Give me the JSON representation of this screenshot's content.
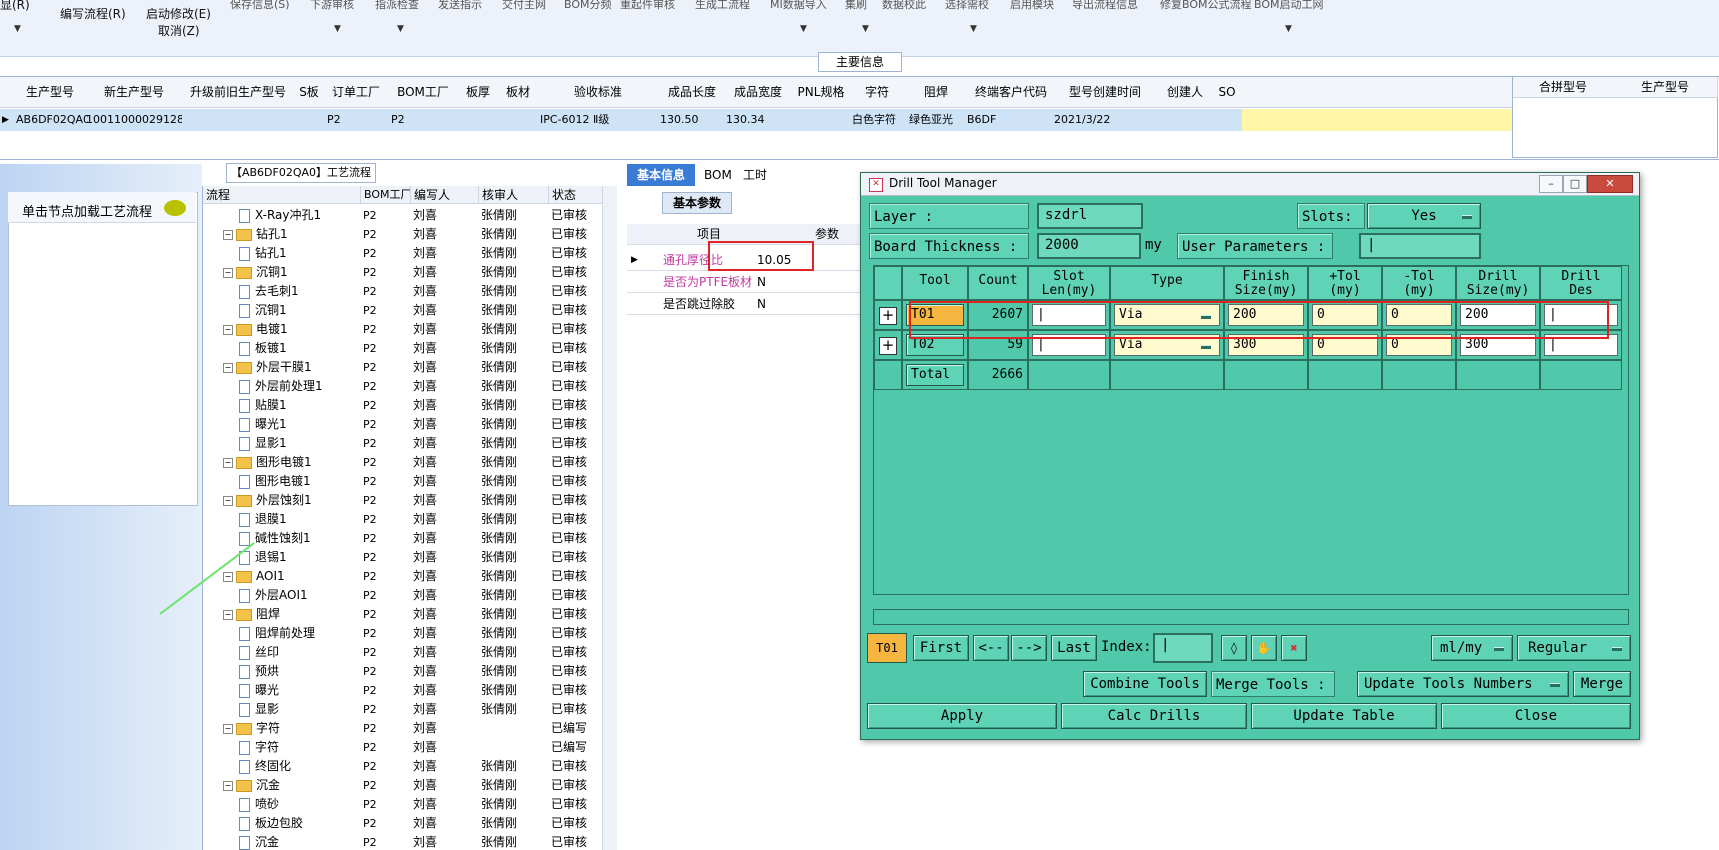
{
  "toolbar": {
    "menu_row": [
      "保存信息(S)",
      "下游审核",
      "指派检查",
      "发送指示",
      "交付主网",
      "BOM分频",
      "重起件审核",
      "生成工流程",
      "MI数据导入",
      "集刷",
      "数据校此",
      "选择需校",
      "启用模块",
      "导出流程信息",
      "修复BOM公式流程",
      "BOM启动工网"
    ],
    "edit_flow": "编写流程(R)",
    "start_modify": "启动修改(E)",
    "cancel": "取消(Z)"
  },
  "main_info": {
    "section_label": "主要信息",
    "headers": [
      "生产型号",
      "新生产型号",
      "升级前旧生产型号",
      "S板",
      "订单工厂",
      "BOM工厂",
      "板厚",
      "板材",
      "验收标准",
      "成品长度",
      "成品宽度",
      "PNL规格",
      "字符",
      "阻焊",
      "终端客户代码",
      "型号创建时间",
      "创建人",
      "SO"
    ],
    "row": [
      "AB6DF02QA0",
      "10011000029128",
      "",
      "",
      "P2",
      "P2",
      "",
      "",
      "IPC-6012 Ⅱ级",
      "130.50",
      "130.34",
      "",
      "白色字符",
      "绿色亚光",
      "B6DF",
      "2021/3/22",
      "",
      ""
    ],
    "merge_headers": [
      "合拼型号",
      "生产型号"
    ]
  },
  "left_panel": {
    "load_label": "单击节点加载工艺流程"
  },
  "flow_tree": {
    "title": "【AB6DF02QA0】工艺流程",
    "headers": [
      "流程",
      "BOM工厂",
      "编写人",
      "核审人",
      "状态"
    ],
    "rows": [
      {
        "kind": "doc",
        "name": "X-Ray冲孔1",
        "factory": "P2",
        "author": "刘喜",
        "reviewer": "张倩刚",
        "status": "已审核"
      },
      {
        "kind": "folder",
        "name": "钻孔1",
        "factory": "P2",
        "author": "刘喜",
        "reviewer": "张倩刚",
        "status": "已审核"
      },
      {
        "kind": "doc",
        "name": "钻孔1",
        "factory": "P2",
        "author": "刘喜",
        "reviewer": "张倩刚",
        "status": "已审核"
      },
      {
        "kind": "folder",
        "name": "沉铜1",
        "factory": "P2",
        "author": "刘喜",
        "reviewer": "张倩刚",
        "status": "已审核"
      },
      {
        "kind": "doc",
        "name": "去毛刺1",
        "factory": "P2",
        "author": "刘喜",
        "reviewer": "张倩刚",
        "status": "已审核"
      },
      {
        "kind": "doc",
        "name": "沉铜1",
        "factory": "P2",
        "author": "刘喜",
        "reviewer": "张倩刚",
        "status": "已审核"
      },
      {
        "kind": "folder",
        "name": "电镀1",
        "factory": "P2",
        "author": "刘喜",
        "reviewer": "张倩刚",
        "status": "已审核"
      },
      {
        "kind": "doc",
        "name": "板镀1",
        "factory": "P2",
        "author": "刘喜",
        "reviewer": "张倩刚",
        "status": "已审核"
      },
      {
        "kind": "folder",
        "name": "外层干膜1",
        "factory": "P2",
        "author": "刘喜",
        "reviewer": "张倩刚",
        "status": "已审核"
      },
      {
        "kind": "doc",
        "name": "外层前处理1",
        "factory": "P2",
        "author": "刘喜",
        "reviewer": "张倩刚",
        "status": "已审核"
      },
      {
        "kind": "doc",
        "name": "贴膜1",
        "factory": "P2",
        "author": "刘喜",
        "reviewer": "张倩刚",
        "status": "已审核"
      },
      {
        "kind": "doc",
        "name": "曝光1",
        "factory": "P2",
        "author": "刘喜",
        "reviewer": "张倩刚",
        "status": "已审核"
      },
      {
        "kind": "doc",
        "name": "显影1",
        "factory": "P2",
        "author": "刘喜",
        "reviewer": "张倩刚",
        "status": "已审核"
      },
      {
        "kind": "folder",
        "name": "图形电镀1",
        "factory": "P2",
        "author": "刘喜",
        "reviewer": "张倩刚",
        "status": "已审核"
      },
      {
        "kind": "doc",
        "name": "图形电镀1",
        "factory": "P2",
        "author": "刘喜",
        "reviewer": "张倩刚",
        "status": "已审核"
      },
      {
        "kind": "folder",
        "name": "外层蚀刻1",
        "factory": "P2",
        "author": "刘喜",
        "reviewer": "张倩刚",
        "status": "已审核"
      },
      {
        "kind": "doc",
        "name": "退膜1",
        "factory": "P2",
        "author": "刘喜",
        "reviewer": "张倩刚",
        "status": "已审核"
      },
      {
        "kind": "doc",
        "name": "碱性蚀刻1",
        "factory": "P2",
        "author": "刘喜",
        "reviewer": "张倩刚",
        "status": "已审核"
      },
      {
        "kind": "doc",
        "name": "退锡1",
        "factory": "P2",
        "author": "刘喜",
        "reviewer": "张倩刚",
        "status": "已审核"
      },
      {
        "kind": "folder",
        "name": "AOI1",
        "factory": "P2",
        "author": "刘喜",
        "reviewer": "张倩刚",
        "status": "已审核"
      },
      {
        "kind": "doc",
        "name": "外层AOI1",
        "factory": "P2",
        "author": "刘喜",
        "reviewer": "张倩刚",
        "status": "已审核"
      },
      {
        "kind": "folder",
        "name": "阻焊",
        "factory": "P2",
        "author": "刘喜",
        "reviewer": "张倩刚",
        "status": "已审核"
      },
      {
        "kind": "doc",
        "name": "阻焊前处理",
        "factory": "P2",
        "author": "刘喜",
        "reviewer": "张倩刚",
        "status": "已审核"
      },
      {
        "kind": "doc",
        "name": "丝印",
        "factory": "P2",
        "author": "刘喜",
        "reviewer": "张倩刚",
        "status": "已审核"
      },
      {
        "kind": "doc",
        "name": "预烘",
        "factory": "P2",
        "author": "刘喜",
        "reviewer": "张倩刚",
        "status": "已审核"
      },
      {
        "kind": "doc",
        "name": "曝光",
        "factory": "P2",
        "author": "刘喜",
        "reviewer": "张倩刚",
        "status": "已审核"
      },
      {
        "kind": "doc",
        "name": "显影",
        "factory": "P2",
        "author": "刘喜",
        "reviewer": "张倩刚",
        "status": "已审核"
      },
      {
        "kind": "folder",
        "name": "字符",
        "factory": "P2",
        "author": "刘喜",
        "reviewer": "",
        "status": "已编写"
      },
      {
        "kind": "doc",
        "name": "字符",
        "factory": "P2",
        "author": "刘喜",
        "reviewer": "",
        "status": "已编写"
      },
      {
        "kind": "doc",
        "name": "终固化",
        "factory": "P2",
        "author": "刘喜",
        "reviewer": "张倩刚",
        "status": "已审核"
      },
      {
        "kind": "folder",
        "name": "沉金",
        "factory": "P2",
        "author": "刘喜",
        "reviewer": "张倩刚",
        "status": "已审核"
      },
      {
        "kind": "doc",
        "name": "喷砂",
        "factory": "P2",
        "author": "刘喜",
        "reviewer": "张倩刚",
        "status": "已审核"
      },
      {
        "kind": "doc",
        "name": "板边包胶",
        "factory": "P2",
        "author": "刘喜",
        "reviewer": "张倩刚",
        "status": "已审核"
      },
      {
        "kind": "doc",
        "name": "沉金",
        "factory": "P2",
        "author": "刘喜",
        "reviewer": "张倩刚",
        "status": "已审核"
      }
    ]
  },
  "center": {
    "tabs": [
      "基本信息",
      "BOM",
      "工时"
    ],
    "subtab": "基本参数",
    "param_headers": [
      "项目",
      "参数"
    ],
    "params": [
      {
        "item": "通孔厚径比",
        "value": "10.05"
      },
      {
        "item": "是否为PTFE板材",
        "value": "N"
      },
      {
        "item": "是否跳过除胶",
        "value": "N"
      }
    ]
  },
  "dialog": {
    "title": "Drill Tool Manager",
    "layer_label": "Layer         :",
    "layer_value": "szdrl",
    "slots_label": "Slots:",
    "slots_value": "Yes",
    "thickness_label": "Board Thickness :",
    "thickness_value": "2000",
    "thickness_unit": "my",
    "user_params_label": "User Parameters :",
    "columns": [
      {
        "line1": "Tool",
        "line2": ""
      },
      {
        "line1": "Count",
        "line2": ""
      },
      {
        "line1": "Slot",
        "line2": "Len(my)"
      },
      {
        "line1": "Type",
        "line2": ""
      },
      {
        "line1": "Finish",
        "line2": "Size(my)"
      },
      {
        "line1": "+Tol",
        "line2": "(my)"
      },
      {
        "line1": "-Tol",
        "line2": "(my)"
      },
      {
        "line1": "Drill",
        "line2": "Size(my)"
      },
      {
        "line1": "Drill",
        "line2": "Des"
      }
    ],
    "tools": [
      {
        "tool": "T01",
        "count": "2607",
        "slot_len": "",
        "type": "Via",
        "finish": "200",
        "ptol": "0",
        "ntol": "0",
        "drill": "200",
        "des": ""
      },
      {
        "tool": "T02",
        "count": "59",
        "slot_len": "",
        "type": "Via",
        "finish": "300",
        "ptol": "0",
        "ntol": "0",
        "drill": "300",
        "des": ""
      }
    ],
    "total_label": "Total",
    "total_count": "2666",
    "current_tool": "T01",
    "nav": {
      "first": "First",
      "prev": "<--",
      "next": "-->",
      "last": "Last",
      "index_label": "Index:"
    },
    "units_value": "ml/my",
    "mode_value": "Regular",
    "combine_tools": "Combine Tools",
    "merge_tools_label": "Merge Tools :",
    "update_tools_numbers": "Update Tools Numbers",
    "merge": "Merge",
    "apply": "Apply",
    "calc_drills": "Calc Drills",
    "update_table": "Update Table",
    "close": "Close"
  }
}
